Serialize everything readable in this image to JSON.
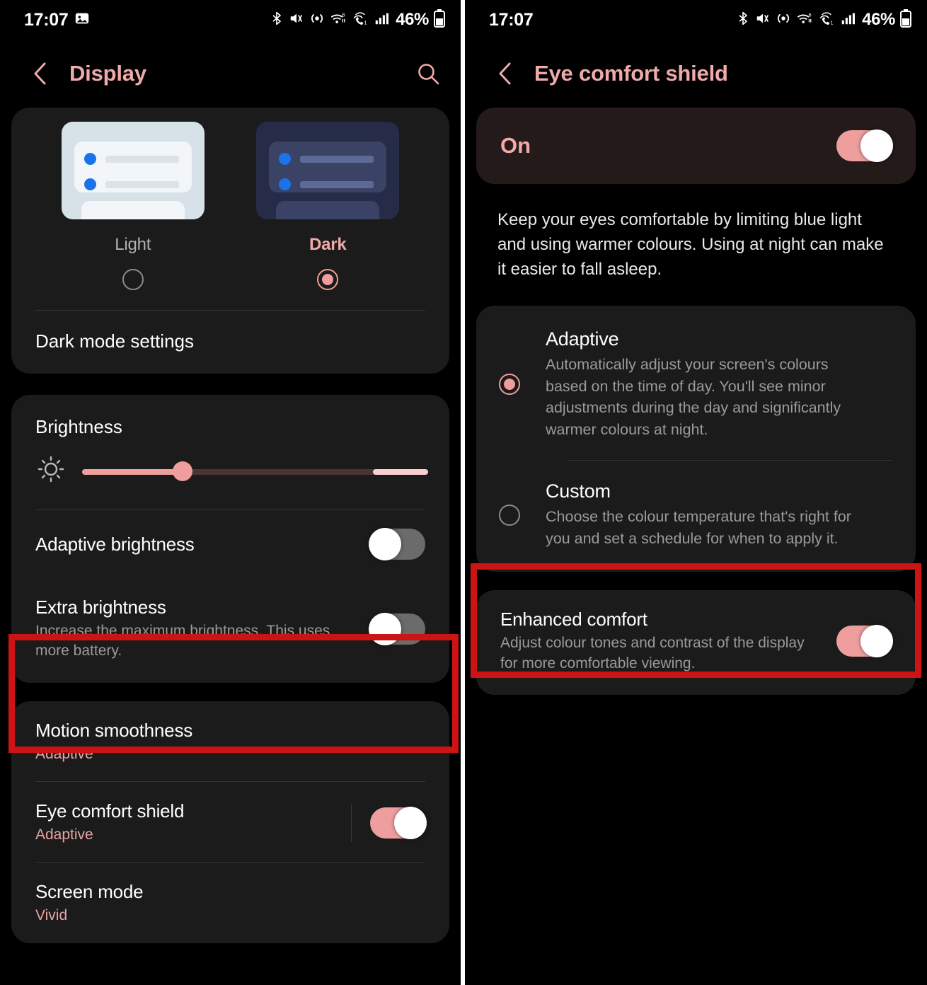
{
  "colors": {
    "accent": "#f1aaaa",
    "accent_toggle": "#ef9e9e",
    "highlight_box": "#cc1414",
    "card_bg": "#1b1b1b",
    "screen_bg": "#000000",
    "on_card_bg": "#241a1a"
  },
  "status_bar": {
    "time": "17:07",
    "battery_percent": "46%",
    "icons_left": [
      "image-icon"
    ],
    "icons_right": [
      "bluetooth-icon",
      "mute-vibrate-icon",
      "hotspot-icon",
      "wifi-6-icon",
      "wifi-calling-icon",
      "signal-bars-icon",
      "battery-icon"
    ]
  },
  "left_screen": {
    "appbar": {
      "back_icon": "chevron-left-icon",
      "title": "Display",
      "search_icon": "search-icon"
    },
    "theme_card": {
      "options": [
        {
          "label": "Light",
          "selected": false
        },
        {
          "label": "Dark",
          "selected": true
        }
      ],
      "dark_mode_settings": "Dark mode settings"
    },
    "brightness_card": {
      "title": "Brightness",
      "slider_icon": "brightness-sun-icon",
      "slider_value_percent": 29,
      "extra_zone_percent": 16,
      "rows": [
        {
          "title": "Adaptive brightness",
          "sub": "",
          "toggle": "off"
        },
        {
          "title": "Extra brightness",
          "sub": "Increase the maximum brightness. This uses more battery.",
          "toggle": "off",
          "highlighted": true
        }
      ]
    },
    "display_card": {
      "rows": [
        {
          "title": "Motion smoothness",
          "sub": "Adaptive",
          "toggle": null
        },
        {
          "title": "Eye comfort shield",
          "sub": "Adaptive",
          "toggle": "on"
        },
        {
          "title": "Screen mode",
          "sub": "Vivid",
          "toggle": null
        }
      ]
    }
  },
  "right_screen": {
    "appbar": {
      "back_icon": "chevron-left-icon",
      "title": "Eye comfort shield"
    },
    "master_switch": {
      "label": "On",
      "toggle": "on"
    },
    "description": "Keep your eyes comfortable by limiting blue light and using warmer colours. Using at night can make it easier to fall asleep.",
    "options": [
      {
        "title": "Adaptive",
        "desc": "Automatically adjust your screen's colours based on the time of day. You'll see minor adjustments during the day and significantly warmer colours at night.",
        "selected": true
      },
      {
        "title": "Custom",
        "desc": "Choose the colour temperature that's right for you and set a schedule for when to apply it.",
        "selected": false
      }
    ],
    "enhanced_comfort": {
      "title": "Enhanced comfort",
      "desc": "Adjust colour tones and contrast of the display for more comfortable viewing.",
      "toggle": "on",
      "highlighted": true
    }
  }
}
